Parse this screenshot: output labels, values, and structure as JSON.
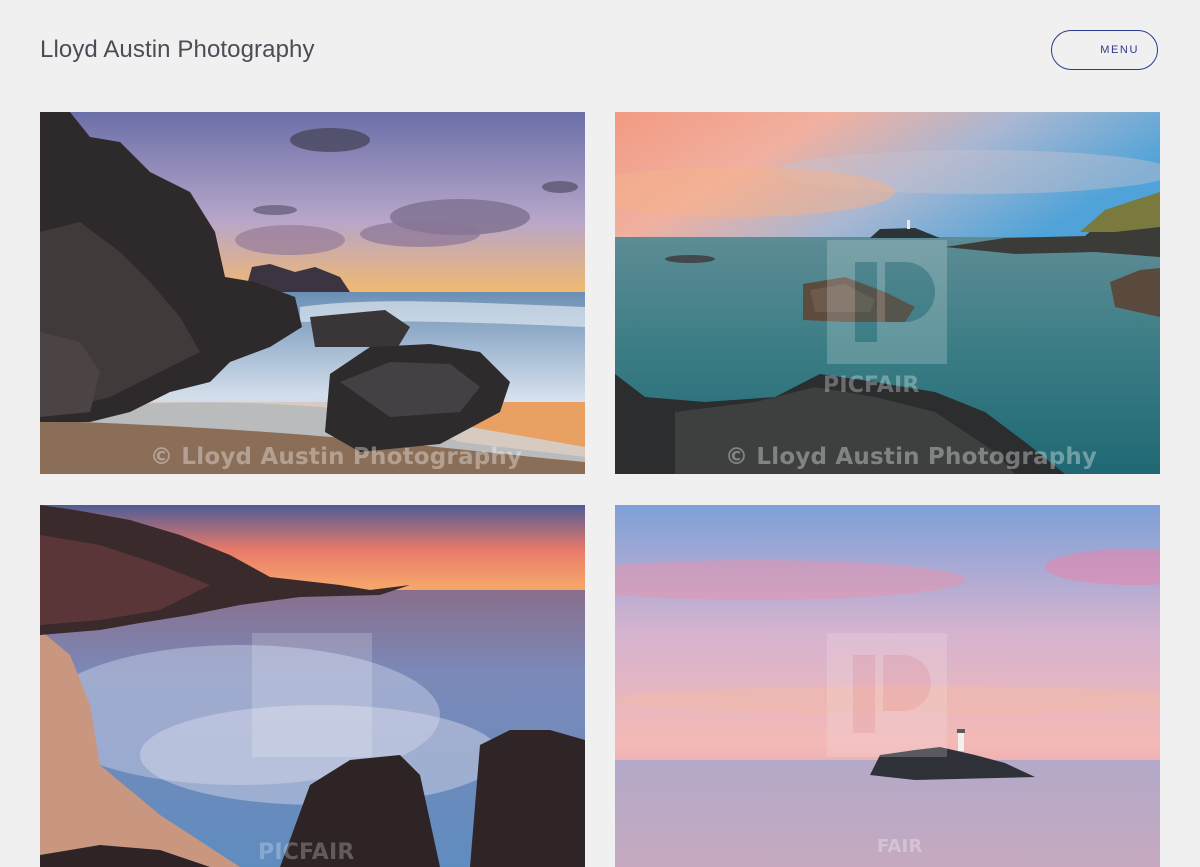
{
  "header": {
    "site_title": "Lloyd Austin Photography",
    "menu_label": "MENU"
  },
  "gallery": {
    "photos": [
      {
        "watermark": "© Lloyd Austin Photography",
        "logo_text": ""
      },
      {
        "watermark": "© Lloyd Austin Photography",
        "logo_text": "PICFAIR"
      },
      {
        "watermark": "",
        "logo_text": "PICFAIR"
      },
      {
        "watermark": "",
        "logo_text": "FAIR"
      }
    ]
  },
  "colors": {
    "background": "#f0f0f0",
    "title_text": "#4a4d55",
    "menu_accent": "#2b3a8c"
  }
}
